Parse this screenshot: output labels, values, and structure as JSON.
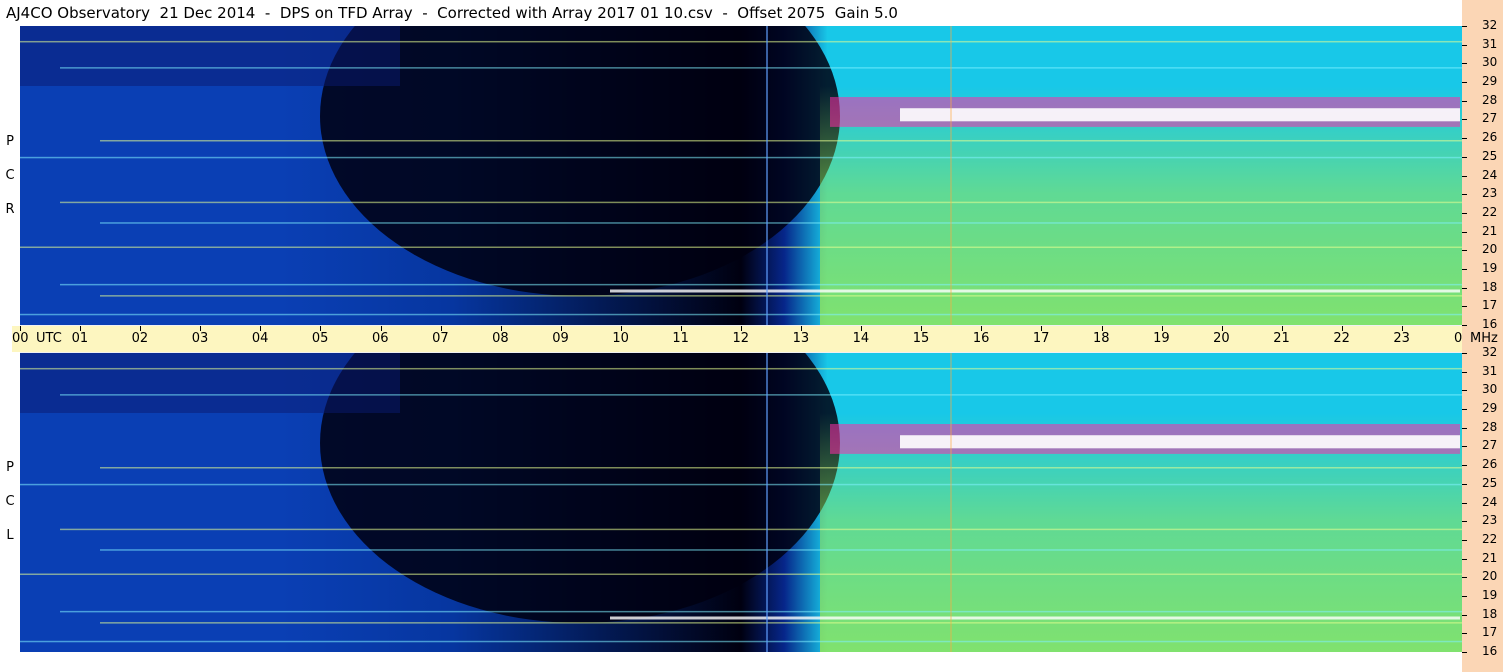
{
  "title": "AJ4CO Observatory  21 Dec 2014  -  DPS on TFD Array  -  Corrected with Array 2017 01 10.csv  -  Offset 2075  Gain 5.0",
  "panels": [
    {
      "id": "top",
      "label_letters": [
        "P",
        "C",
        "R"
      ]
    },
    {
      "id": "bottom",
      "label_letters": [
        "P",
        "C",
        "L"
      ]
    }
  ],
  "colors": {
    "night_dark": "#000010",
    "night_blue": "#0a3fb4",
    "day_cyan": "#18c8e8",
    "day_green": "#9ae850",
    "hot_magenta": "#ff2ca8",
    "hot_white": "#ffffff",
    "axis_bg": "#fdf6c0",
    "freq_bg": "#fbd6b5"
  },
  "chart_data": {
    "type": "heatmap",
    "x_unit": "UTC",
    "y_unit": "MHz",
    "x_ticks": [
      "00",
      "01",
      "02",
      "03",
      "04",
      "05",
      "06",
      "07",
      "08",
      "09",
      "10",
      "11",
      "12",
      "13",
      "14",
      "15",
      "16",
      "17",
      "18",
      "19",
      "20",
      "21",
      "22",
      "23",
      "00"
    ],
    "y_ticks": [
      16,
      17,
      18,
      19,
      20,
      21,
      22,
      23,
      24,
      25,
      26,
      27,
      28,
      29,
      30,
      31,
      32
    ],
    "ylim": [
      16,
      32
    ],
    "x_label_utc": "UTC",
    "y_label_mhz": "MHz",
    "series": [
      {
        "name": "RCP"
      },
      {
        "name": "LCP"
      }
    ]
  }
}
